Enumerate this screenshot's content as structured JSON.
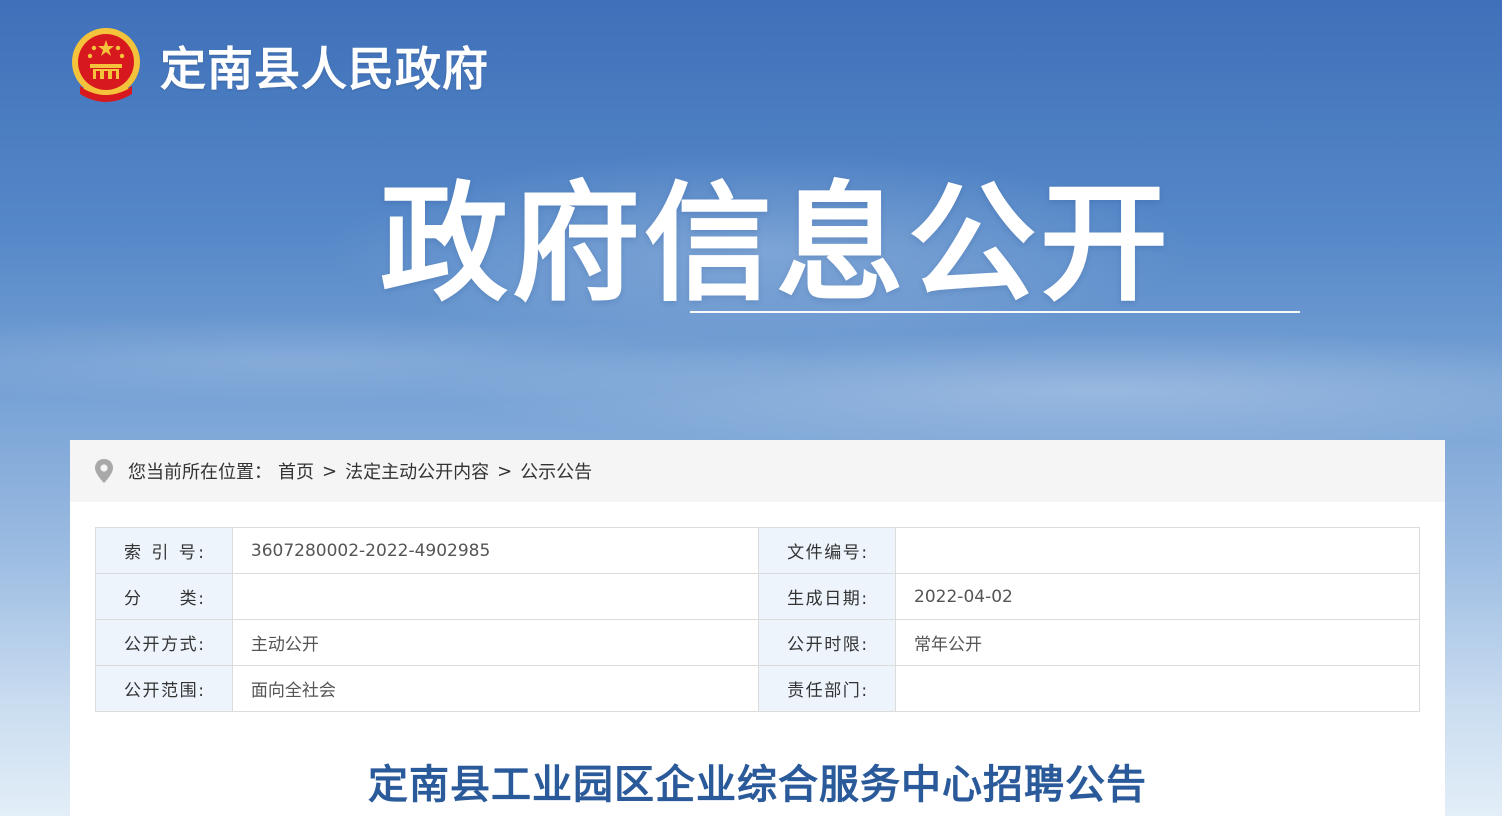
{
  "header": {
    "site_title": "定南县人民政府"
  },
  "hero": {
    "title": "政府信息公开"
  },
  "breadcrumb": {
    "prefix": "您当前所在位置：",
    "items": [
      "首页",
      "法定主动公开内容",
      "公示公告"
    ],
    "separator": ">"
  },
  "meta": {
    "rows": [
      {
        "label1": "索 引 号:",
        "value1": "3607280002-2022-4902985",
        "label2": "文件编号:",
        "value2": ""
      },
      {
        "label1": "分　　类:",
        "value1": "",
        "label2": "生成日期:",
        "value2": "2022-04-02"
      },
      {
        "label1": "公开方式:",
        "value1": "主动公开",
        "label2": "公开时限:",
        "value2": "常年公开"
      },
      {
        "label1": "公开范围:",
        "value1": "面向全社会",
        "label2": "责任部门:",
        "value2": ""
      }
    ]
  },
  "article": {
    "title": "定南县工业园区企业综合服务中心招聘公告"
  },
  "colors": {
    "accent": "#2a5a9a",
    "label_bg": "#edf4fc",
    "emblem_red": "#d7191f",
    "emblem_gold": "#f5c33b"
  },
  "icons": {
    "emblem": "national-emblem-icon",
    "location": "location-pin-icon"
  }
}
